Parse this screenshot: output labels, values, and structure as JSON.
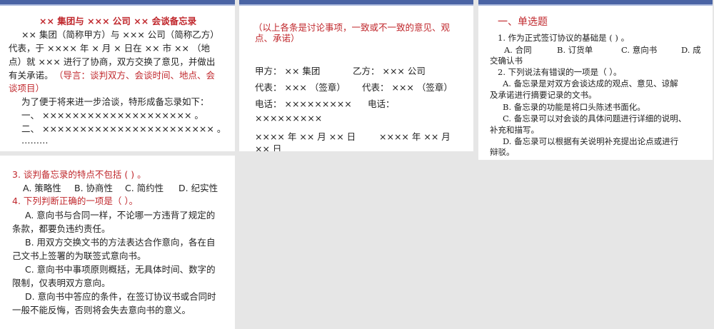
{
  "slides": [
    {
      "title": "×× 集团与 ××× 公司 ×× 会谈备忘录",
      "lines": [
        "×× 集团（简称甲方）与 ××× 公司（简称乙方）",
        "代表，于 ×××× 年 × 月 × 日在 ×× 市 ××  （地",
        "点）就 ××× 进行了协商，双方交换了意见，并做出",
        "有关承诺。"
      ],
      "note_a": "（导言：谈判双方、会谈时间、地点、会",
      "note_b": "谈项目）",
      "body": [
        "为了便于将来进一步洽谈，特形成备忘录如下：",
        "一、 ×××××××××××××××××××× 。",
        "二、 ××××××××××××××××××××××× 。",
        "………"
      ]
    },
    {
      "note": [
        "（以上各条是讨论事项，一致或不一致的意见、观",
        "点、承诺）"
      ],
      "lines": [
        "甲方： ×× 集团",
        "乙方： ××× 公司",
        "代表： ×××  （签章）",
        "代表： ×××  （签章）",
        "电话： ×××××××××",
        "电话：",
        "×××××××××",
        "×××× 年 ×× 月 ×× 日",
        "×××× 年 ×× 月",
        "×× 日"
      ]
    },
    {
      "heading": "一、单选题",
      "lines": [
        "1. 作为正式签订协议的基础是 (        ) 。",
        "A. 合同",
        "B. 订货单",
        "C. 意向书",
        "D. 成",
        "交确认书",
        "2. 下列说法有错误的一项是（        ）。",
        "A. 备忘录是对双方会谈达成的观点、意见、谅解",
        "及承诺进行摘要记录的文书。",
        "B. 备忘录的功能是将口头陈述书面化。",
        "C. 备忘录可以对会谈的具体问题进行详细的说明、",
        "补充和描写。",
        "D. 备忘录可以根据有关说明补充提出论点或进行",
        "辩驳。"
      ]
    },
    {
      "q3": "3. 谈判备忘录的特点不包括 ( ) 。",
      "q3_options": [
        "A. 策略性",
        "B. 协商性",
        "C. 简约性",
        "D. 纪实性"
      ],
      "q4": "4. 下列判断正确的一项是（    ）。",
      "lines": [
        "A. 意向书与合同一样，不论哪一方违背了规定的",
        "条款，都要负违约责任。",
        "B. 用双方交换文书的方法表达合作意向，各在自",
        "己文书上签署的为联签式意向书。",
        "C. 意向书中事项原则概括，无具体时间、数字的",
        "限制，仅表明双方意向。",
        "D. 意向书中答应的条件，在签订协议书或合同时",
        "一般不能反悔，否则将会失去意向书的意义。"
      ]
    }
  ]
}
